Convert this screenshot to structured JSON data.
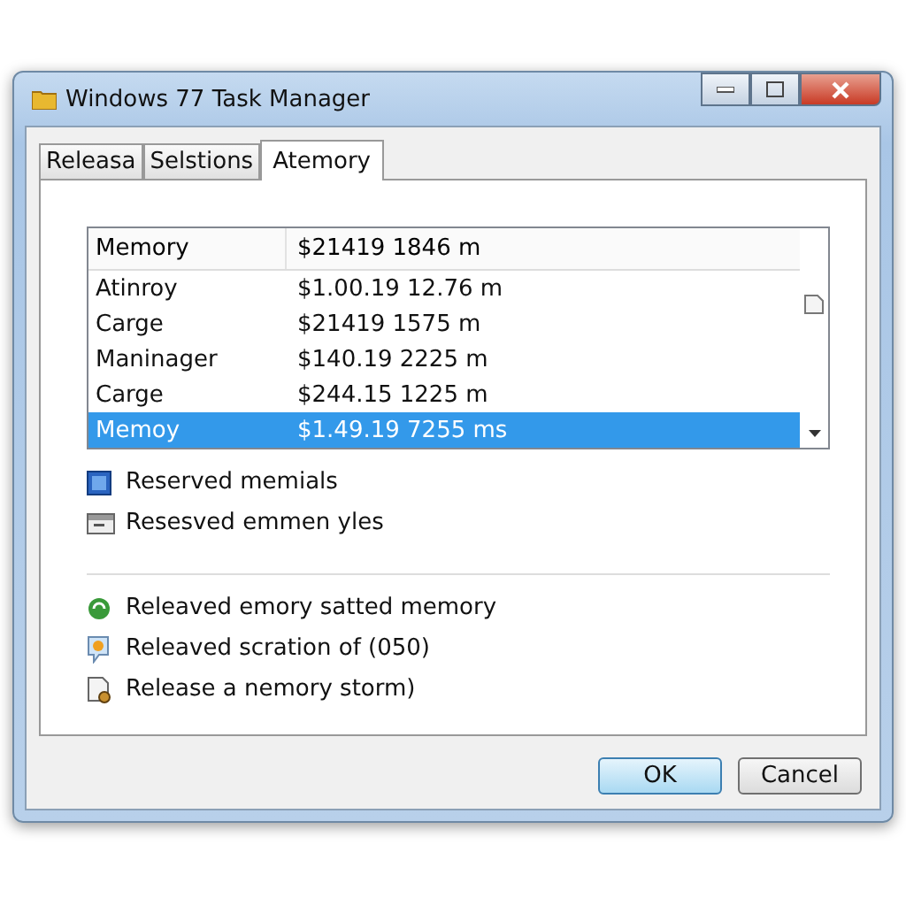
{
  "window": {
    "title": "Windows 77 Task Manager"
  },
  "tabs": [
    {
      "label": "Releasa",
      "selected": false
    },
    {
      "label": "Selstions",
      "selected": false
    },
    {
      "label": "Atemory",
      "selected": true
    }
  ],
  "list": {
    "header": [
      "Memory",
      "$21419 1846 m"
    ],
    "rows": [
      {
        "name": "Atinroy",
        "value": "$1.00.19 12.76 m",
        "selected": false
      },
      {
        "name": "Carge",
        "value": "$21419 1575 m",
        "selected": false
      },
      {
        "name": "Maninager",
        "value": "$140.19 2225 m",
        "selected": false
      },
      {
        "name": "Carge",
        "value": "$244.15 1225 m",
        "selected": false
      },
      {
        "name": "Memoy",
        "value": "$1.49.19 7255 ms",
        "selected": true
      }
    ]
  },
  "groups": [
    [
      "Reserved memials",
      "Resesved emmen yles"
    ],
    [
      "Releaved emory satted memory",
      "Releaved scration of (050)",
      "Release a nemory storm)"
    ]
  ],
  "buttons": [
    {
      "label": "OK",
      "default": true
    },
    {
      "label": "Cancel",
      "default": false
    }
  ]
}
